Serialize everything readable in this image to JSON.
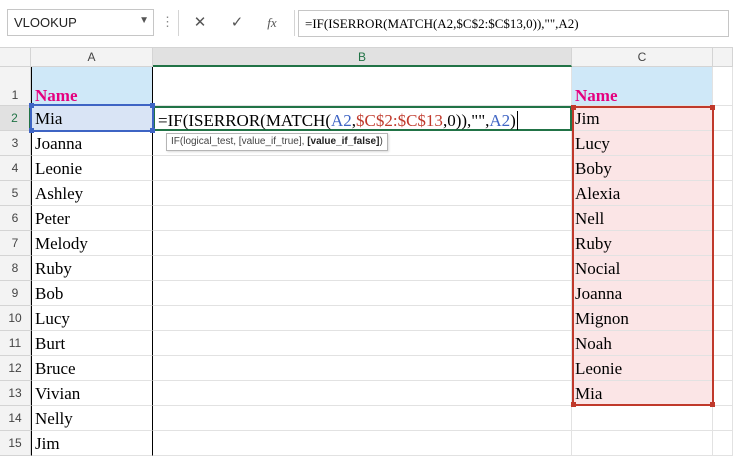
{
  "formula_bar": {
    "name_box": "VLOOKUP",
    "cancel_icon": "✕",
    "enter_icon": "✓",
    "fx_label": "fx",
    "formula": "=IF(ISERROR(MATCH(A2,$C$2:$C$13,0)),\"\",A2)"
  },
  "columns": [
    "A",
    "B",
    "C"
  ],
  "rows": [
    "1",
    "2",
    "3",
    "4",
    "5",
    "6",
    "7",
    "8",
    "9",
    "10",
    "11",
    "12",
    "13",
    "14",
    "15"
  ],
  "header_row": {
    "a": "Name",
    "c": "Name"
  },
  "col_a": [
    "Mia",
    "Joanna",
    "Leonie",
    "Ashley",
    "Peter",
    "Melody",
    "Ruby",
    "Bob",
    "Lucy",
    "Burt",
    "Bruce",
    "Vivian",
    "Nelly",
    "Jim"
  ],
  "col_c": [
    "Jim",
    "Lucy",
    "Boby",
    "Alexia",
    "Nell",
    "Ruby",
    "Nocial",
    "Joanna",
    "Mignon",
    "Noah",
    "Leonie",
    "Mia"
  ],
  "edit_cell": {
    "p1": "=IF(ISERROR(MATCH(",
    "p2": "A2",
    "p3": ",",
    "p4": "$C$2:$C$13",
    "p5": ",0)),\"\",",
    "p6": "A2",
    "p7": ")"
  },
  "tooltip": {
    "prefix": "IF(logical_test, [value_if_true], ",
    "bold": "[value_if_false]",
    "suffix": ")"
  },
  "colors": {
    "accent": "#217346",
    "name_header": "#e5007e",
    "ref_blue": "#3e64c4",
    "ref_red": "#c0392b"
  }
}
